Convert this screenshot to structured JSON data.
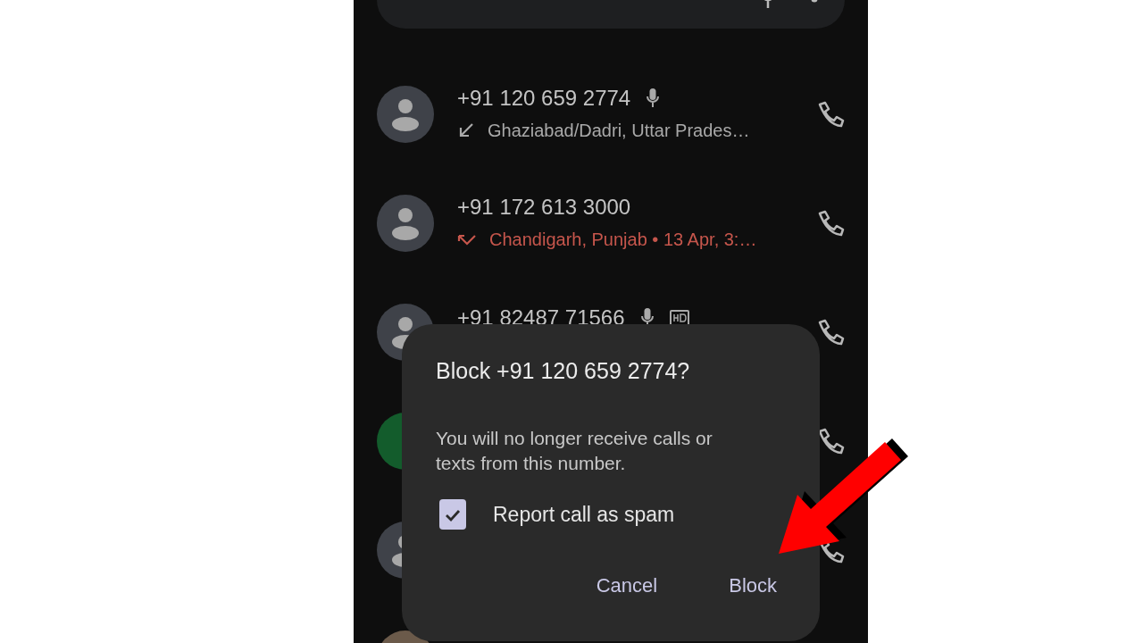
{
  "calls": [
    {
      "kind": "generic",
      "number": "+91 120 659 2774",
      "recorded": true,
      "hd": false,
      "detail": {
        "kind": "incoming",
        "text": "Ghaziabad/Dadri, Uttar Prades…"
      }
    },
    {
      "kind": "generic",
      "number": "+91 172 613 3000",
      "recorded": false,
      "hd": false,
      "detail": {
        "kind": "missed",
        "text": "Chandigarh, Punjab • 13 Apr, 3:…"
      }
    },
    {
      "kind": "generic",
      "number": "+91 82487 71566",
      "recorded": true,
      "hd": true
    },
    {
      "kind": "letter",
      "color": "#135c2c"
    },
    {
      "kind": "generic"
    },
    {
      "kind": "photo"
    }
  ],
  "dialog": {
    "title": "Block +91 120 659 2774?",
    "message": "You will no longer receive calls or texts from this number.",
    "checkbox": {
      "label": "Report call as spam",
      "checked": true
    },
    "buttons": [
      "Cancel",
      "Block"
    ]
  }
}
